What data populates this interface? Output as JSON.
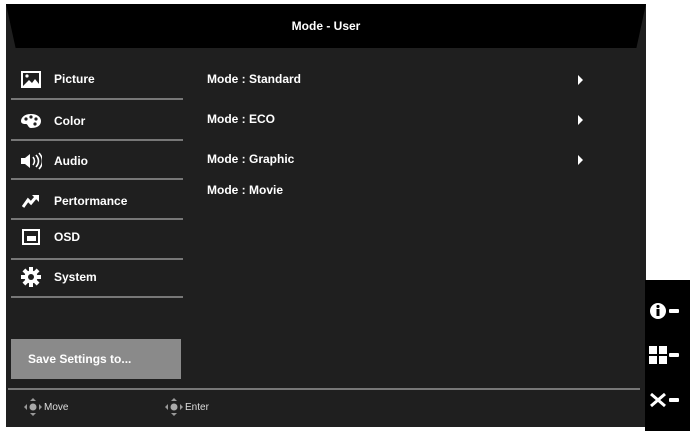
{
  "header": {
    "title": "Mode - User"
  },
  "sidebar": {
    "items": [
      {
        "label": "Picture",
        "icon": "picture-icon"
      },
      {
        "label": "Color",
        "icon": "palette-icon"
      },
      {
        "label": "Audio",
        "icon": "speaker-icon"
      },
      {
        "label": "Pertormance",
        "icon": "performance-icon"
      },
      {
        "label": "OSD",
        "icon": "osd-icon"
      },
      {
        "label": "System",
        "icon": "gear-icon"
      }
    ],
    "save_label": "Save Settings to..."
  },
  "modes": [
    {
      "label": "Mode : Standard",
      "has_submenu": true
    },
    {
      "label": "Mode : ECO",
      "has_submenu": true
    },
    {
      "label": "Mode : Graphic",
      "has_submenu": true
    },
    {
      "label": "Mode : Movie",
      "has_submenu": false
    }
  ],
  "footer": {
    "move": "Move",
    "enter": "Enter"
  },
  "keys": [
    "info-icon",
    "menu-grid-icon",
    "close-icon"
  ]
}
